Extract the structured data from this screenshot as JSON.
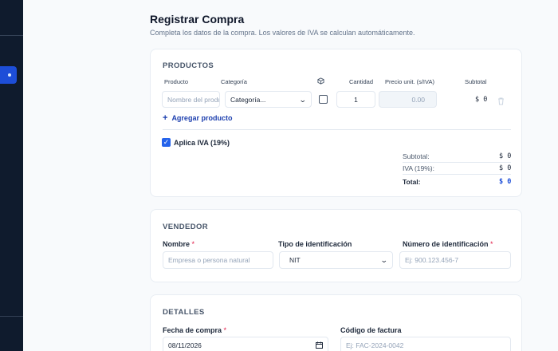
{
  "header": {
    "title": "Registrar Compra",
    "subtitle": "Completa los datos de la compra. Los valores de IVA se calculan automáticamente."
  },
  "productos": {
    "section_title": "PRODUCTOS",
    "columns": {
      "producto": "Producto",
      "categoria": "Categoría",
      "cantidad": "Cantidad",
      "precio": "Precio unit. (s/IVA)",
      "subtotal": "Subtotal"
    },
    "row": {
      "nombre_placeholder": "Nombre del producto",
      "categoria_value": "Categoría...",
      "cantidad_value": "1",
      "precio_placeholder": "0.00",
      "subtotal": "$ 0"
    },
    "add_label": "Agregar producto",
    "iva_label": "Aplica IVA (19%)",
    "totals": {
      "subtotal_label": "Subtotal:",
      "subtotal_value": "$ 0",
      "iva_label": "IVA (19%):",
      "iva_value": "$ 0",
      "total_label": "Total:",
      "total_value": "$ 0"
    }
  },
  "vendedor": {
    "section_title": "VENDEDOR",
    "nombre_label": "Nombre",
    "required_mark": "*",
    "nombre_placeholder": "Empresa o persona natural",
    "tipo_label": "Tipo de identificación",
    "tipo_value": "NIT",
    "numero_label": "Número de identificación",
    "numero_placeholder": "Ej: 900.123.456-7"
  },
  "detalles": {
    "section_title": "DETALLES",
    "fecha_label": "Fecha de compra",
    "fecha_value": "08/11/2026",
    "codigo_label": "Código de factura",
    "codigo_placeholder": "Ej: FAC-2024-0042"
  },
  "colors": {
    "sidebar": "#0f1b2d",
    "accent": "#2563eb",
    "required": "#e11d48"
  }
}
